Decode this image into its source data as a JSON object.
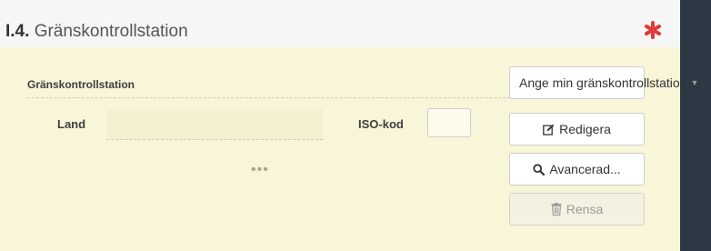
{
  "section": {
    "number": "I.4.",
    "title": "Gränskontrollstation"
  },
  "colors": {
    "required_mark": "#e23a3a",
    "panel_body": "#f8f5d8",
    "dark_sidebar": "#2c3844"
  },
  "form": {
    "group_label": "Gränskontrollstation",
    "land_label": "Land",
    "land_value": "",
    "iso_label": "ISO-kod",
    "iso_value": "",
    "more_indicator": "•••"
  },
  "buttons": {
    "ange": {
      "label": "Ange min gränskontrollstation",
      "icon": "caret-down-icon"
    },
    "redigera": {
      "label": "Redigera",
      "icon": "edit-icon"
    },
    "avancerad": {
      "label": "Avancerad...",
      "icon": "search-icon"
    },
    "rensa": {
      "label": "Rensa",
      "icon": "trash-icon",
      "disabled": true
    }
  }
}
